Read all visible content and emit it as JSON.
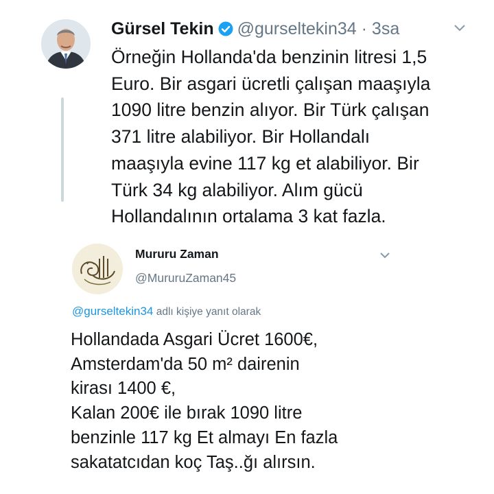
{
  "tweet": {
    "author_name": "Gürsel Tekin",
    "handle": "@gurseltekin34",
    "separator": "·",
    "time": "3sa",
    "avatar_icon": "user-avatar-photo",
    "verified_icon": "verified-badge-icon",
    "menu_icon": "chevron-down-icon",
    "colors": {
      "verified": "#1da1f2",
      "secondary": "#657786",
      "thread_line": "#ccd6dd"
    },
    "lines": [
      "Örneğin Hollanda'da benzinin litresi 1,5",
      "Euro. Bir asgari ücretli çalışan maaşıyla",
      "1090 litre benzin alıyor. Bir Türk çalışan",
      "371 litre alabiliyor. Bir Hollandalı",
      "maaşıyla evine 117 kg et alabiliyor.  Bir",
      "Türk 34 kg alabiliyor. Alım gücü",
      "Hollandalının ortalama 3 kat fazla."
    ]
  },
  "reply": {
    "author_name": "Mururu Zaman",
    "handle": "@MururuZaman45",
    "avatar_icon": "tughra-emblem-avatar",
    "menu_icon": "chevron-down-icon",
    "replying_mention": "@gurseltekin34",
    "replying_text": "adlı kişiye yanıt olarak",
    "colors": {
      "mention": "#1b95e0"
    },
    "lines": [
      "Hollandada Asgari Ücret 1600€,",
      "Amsterdam'da 50 m² dairenin",
      "kirası 1400 €,",
      "Kalan 200€ ile bırak 1090 litre",
      "benzinle 117 kg Et almayı En fazla",
      "sakatatcıdan koç Taş..ğı alırsın."
    ]
  }
}
